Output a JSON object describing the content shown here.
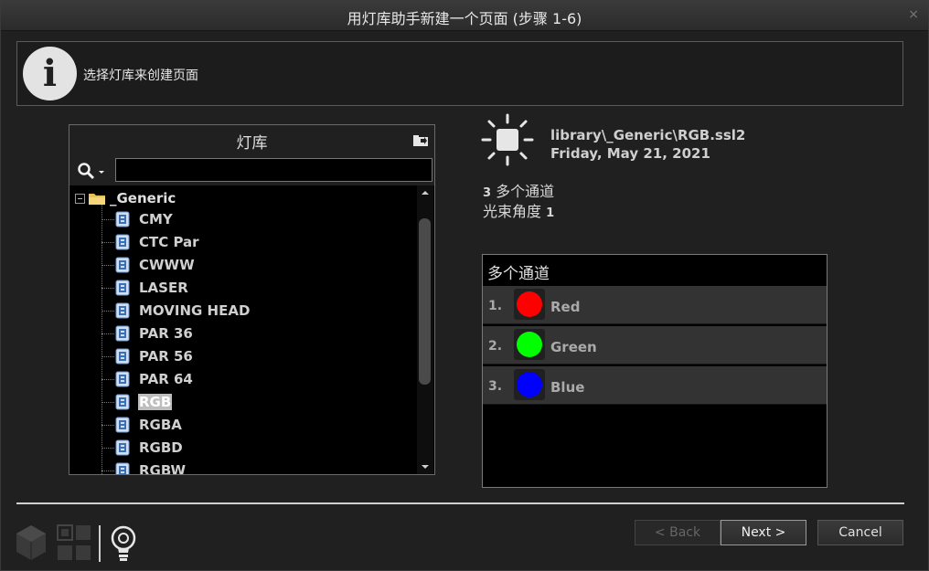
{
  "window": {
    "title": "用灯库助手新建一个页面 (步骤 1-6)",
    "close_glyph": "×"
  },
  "info": {
    "icon_glyph": "i",
    "text": "选择灯库来创建页面"
  },
  "library": {
    "title": "灯库",
    "search_value": "",
    "folder": "_Generic",
    "items": [
      {
        "label": "CMY",
        "selected": false
      },
      {
        "label": "CTC Par",
        "selected": false
      },
      {
        "label": "CWWW",
        "selected": false
      },
      {
        "label": "LASER",
        "selected": false
      },
      {
        "label": "MOVING HEAD",
        "selected": false
      },
      {
        "label": "PAR 36",
        "selected": false
      },
      {
        "label": "PAR 56",
        "selected": false
      },
      {
        "label": "PAR 64",
        "selected": false
      },
      {
        "label": "RGB",
        "selected": true
      },
      {
        "label": "RGBA",
        "selected": false
      },
      {
        "label": "RGBD",
        "selected": false
      },
      {
        "label": "RGBW",
        "selected": false
      }
    ]
  },
  "details": {
    "path": "library\\_Generic\\RGB.ssl2",
    "date": "Friday, May 21, 2021",
    "channel_count": "3",
    "channels_label": "多个通道",
    "beam_label": "光束角度",
    "beam_value": "1"
  },
  "channels": {
    "title": "多个通道",
    "rows": [
      {
        "num": "1.",
        "name": "Red",
        "color": "#ff0000"
      },
      {
        "num": "2.",
        "name": "Green",
        "color": "#00ff00"
      },
      {
        "num": "3.",
        "name": "Blue",
        "color": "#0000ff"
      }
    ]
  },
  "footer": {
    "back_label": "< Back",
    "next_label": "Next >",
    "cancel_label": "Cancel",
    "icons": [
      "3d-box-icon",
      "grid-icon",
      "lightbulb-icon"
    ]
  }
}
